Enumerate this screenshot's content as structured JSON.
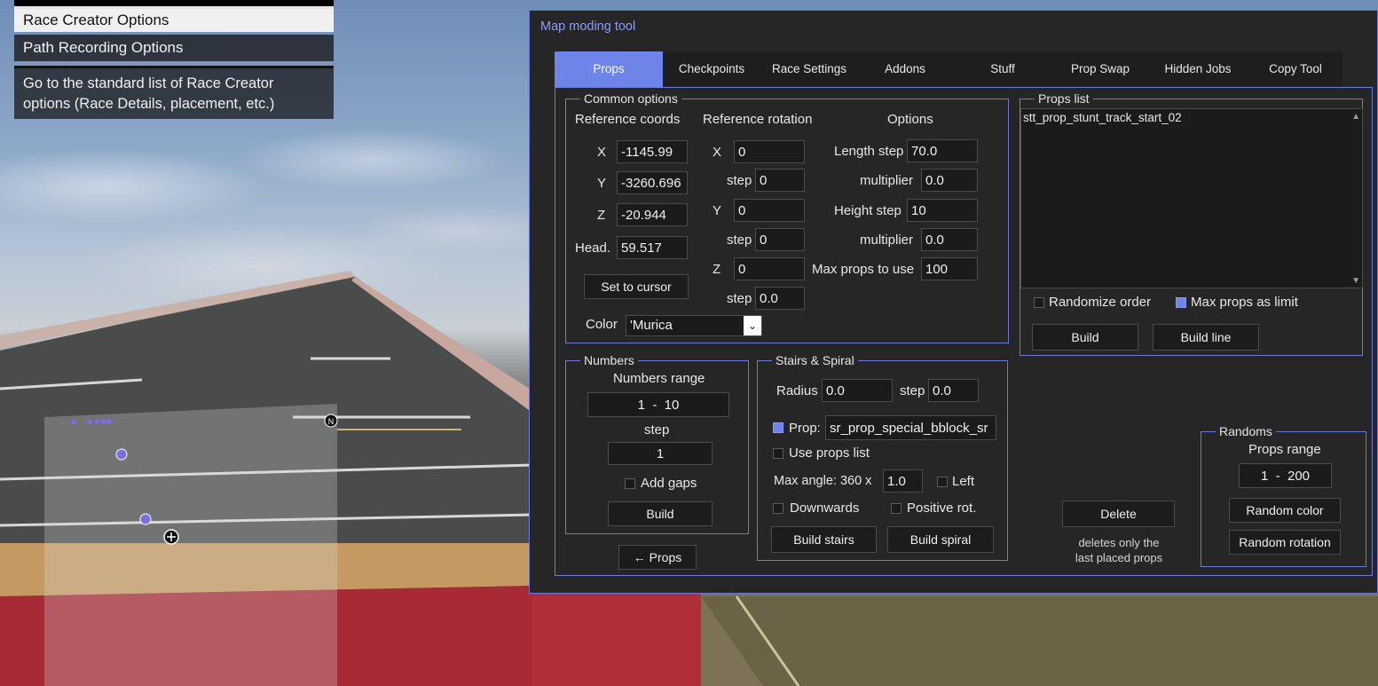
{
  "race_menu": {
    "items": [
      {
        "label": "Race Creator Options"
      },
      {
        "label": "Path Recording Options"
      }
    ],
    "description": "Go to the standard list of Race Creator options (Race Details, placement, etc.)"
  },
  "map_marker": {
    "north_label": "N"
  },
  "window": {
    "title": "Map moding tool",
    "tabs": [
      {
        "label": "Props",
        "active": true
      },
      {
        "label": "Checkpoints"
      },
      {
        "label": "Race Settings"
      },
      {
        "label": "Addons"
      },
      {
        "label": "Stuff"
      },
      {
        "label": "Prop Swap"
      },
      {
        "label": "Hidden Jobs"
      },
      {
        "label": "Copy Tool"
      }
    ],
    "accent_color": "#6f84e8"
  },
  "common": {
    "legend": "Common options",
    "ref_coords_header": "Reference coords",
    "ref_rotation_header": "Reference rotation",
    "options_header": "Options",
    "coords": {
      "x_label": "X",
      "x": "-1145.99",
      "y_label": "Y",
      "y": "-3260.696",
      "z_label": "Z",
      "z": "-20.944",
      "head_label": "Head.",
      "head": "59.517"
    },
    "rotation": {
      "x_label": "X",
      "x": "0",
      "x_step_label": "step",
      "x_step": "0",
      "y_label": "Y",
      "y": "0",
      "y_step_label": "step",
      "y_step": "0",
      "z_label": "Z",
      "z": "0",
      "z_step_label": "step",
      "z_step": "0.0"
    },
    "options": {
      "length_step_label": "Length step",
      "length_step": "70.0",
      "length_mult_label": "multiplier",
      "length_mult": "0.0",
      "height_step_label": "Height step",
      "height_step": "10",
      "height_mult_label": "multiplier",
      "height_mult": "0.0",
      "max_props_label": "Max props to use",
      "max_props": "100"
    },
    "set_to_cursor": "Set to cursor",
    "color_label": "Color",
    "color_value": "'Murica"
  },
  "props_list": {
    "legend": "Props list",
    "items": [
      "stt_prop_stunt_track_start_02"
    ],
    "randomize_order": {
      "label": "Randomize order",
      "checked": false
    },
    "max_props_limit": {
      "label": "Max props as limit",
      "checked": true
    },
    "build": "Build",
    "build_line": "Build line"
  },
  "numbers": {
    "legend": "Numbers",
    "range_label": "Numbers range",
    "range_value": "1  -  10",
    "step_label": "step",
    "step_value": "1",
    "add_gaps": {
      "label": "Add gaps",
      "checked": false
    },
    "build": "Build"
  },
  "back_button": "← Props",
  "stairs": {
    "legend": "Stairs & Spiral",
    "radius_label": "Radius",
    "radius": "0.0",
    "step_label": "step",
    "step": "0.0",
    "prop": {
      "label": "Prop:",
      "checked": true,
      "value": "sr_prop_special_bblock_sr"
    },
    "use_props_list": {
      "label": "Use props list",
      "checked": false
    },
    "max_angle_label": "Max angle: 360 x",
    "max_angle": "1.0",
    "left": {
      "label": "Left",
      "checked": false
    },
    "downwards": {
      "label": "Downwards",
      "checked": false
    },
    "positive_rot": {
      "label": "Positive rot.",
      "checked": false
    },
    "build_stairs": "Build stairs",
    "build_spiral": "Build spiral"
  },
  "delete": {
    "button": "Delete",
    "note_line1": "deletes only the",
    "note_line2": "last placed props"
  },
  "randoms": {
    "legend": "Randoms",
    "range_label": "Props range",
    "range_value": "1  -  200",
    "random_color": "Random color",
    "random_rotation": "Random rotation"
  }
}
